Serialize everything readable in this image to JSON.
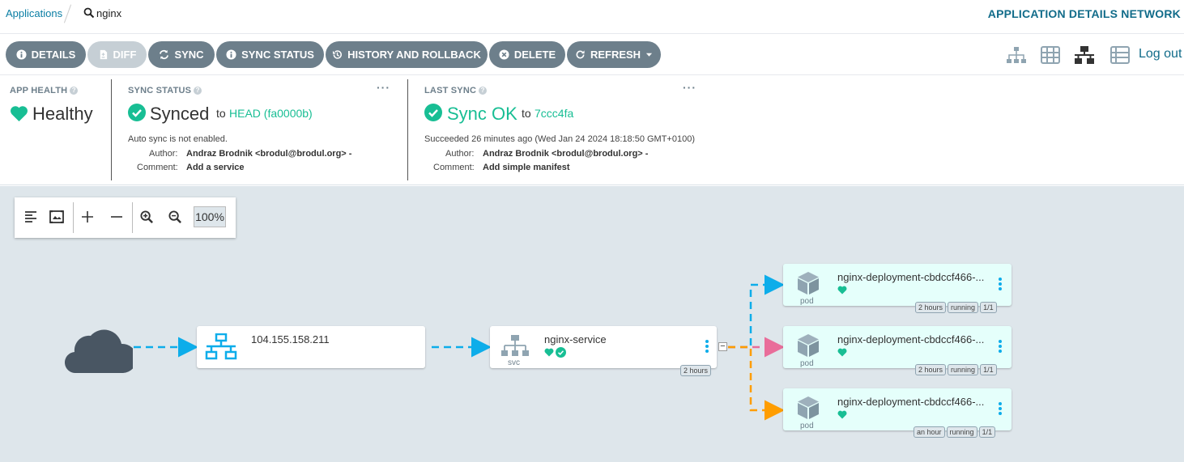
{
  "breadcrumb": {
    "applications": "Applications",
    "app_name": "nginx"
  },
  "page_title": "APPLICATION DETAILS NETWORK",
  "toolbar": {
    "details": "DETAILS",
    "diff": "DIFF",
    "sync": "SYNC",
    "sync_status": "SYNC STATUS",
    "history": "HISTORY AND ROLLBACK",
    "delete": "DELETE",
    "refresh": "REFRESH",
    "logout": "Log out"
  },
  "app_health": {
    "label": "APP HEALTH",
    "value": "Healthy"
  },
  "sync_status": {
    "label": "SYNC STATUS",
    "value": "Synced",
    "to": "to",
    "revision": "HEAD (fa0000b)",
    "auto_sync": "Auto sync is not enabled.",
    "author_label": "Author:",
    "author": "Andraz Brodnik <brodul@brodul.org> -",
    "comment_label": "Comment:",
    "comment": "Add a service"
  },
  "last_sync": {
    "label": "LAST SYNC",
    "value": "Sync OK",
    "to": "to",
    "revision": "7ccc4fa",
    "succeeded": "Succeeded 26 minutes ago (Wed Jan 24 2024 18:18:50 GMT+0100)",
    "author_label": "Author:",
    "author": "Andraz Brodnik <brodul@brodul.org> -",
    "comment_label": "Comment:",
    "comment": "Add simple manifest"
  },
  "zoom": {
    "level": "100%"
  },
  "graph": {
    "ip_node": {
      "name": "104.155.158.211"
    },
    "service_node": {
      "name": "nginx-service",
      "kind": "svc",
      "age": "2 hours"
    },
    "pods": [
      {
        "name": "nginx-deployment-cbdccf466-...",
        "kind": "pod",
        "age": "2 hours",
        "status": "running",
        "ready": "1/1"
      },
      {
        "name": "nginx-deployment-cbdccf466-...",
        "kind": "pod",
        "age": "2 hours",
        "status": "running",
        "ready": "1/1"
      },
      {
        "name": "nginx-deployment-cbdccf466-...",
        "kind": "pod",
        "age": "an hour",
        "status": "running",
        "ready": "1/1"
      }
    ],
    "collapse_symbol": "−"
  },
  "colors": {
    "accent": "#18be94",
    "link": "#0a7ea4",
    "button": "#6d7f8b",
    "edge_blue": "#0dadea",
    "edge_pink": "#e96d9a",
    "edge_orange": "#ff9d00",
    "canvas": "#dee6eb"
  }
}
